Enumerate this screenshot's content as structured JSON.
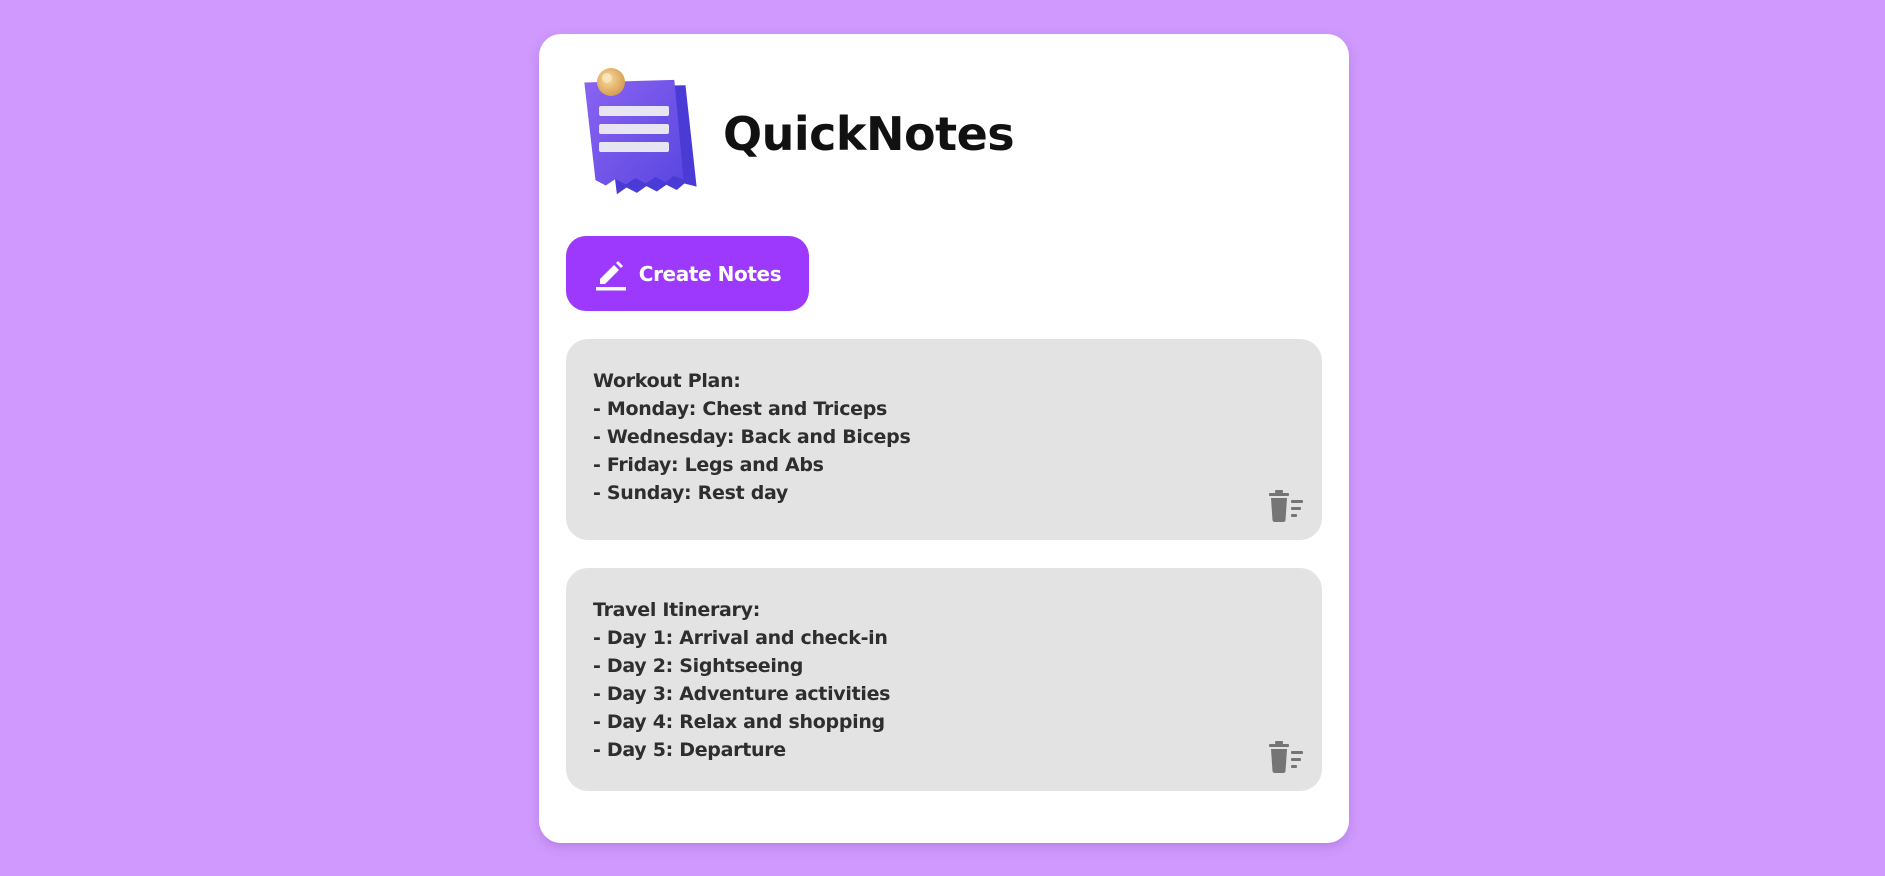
{
  "app": {
    "title": "QuickNotes",
    "logo_icon": "notes-logo-icon"
  },
  "toolbar": {
    "create_label": "Create Notes",
    "create_icon": "pencil-icon"
  },
  "notes": [
    {
      "text": "Workout Plan:\n- Monday: Chest and Triceps\n- Wednesday: Back and Biceps\n- Friday: Legs and Abs\n- Sunday: Rest day",
      "delete_icon": "delete-icon"
    },
    {
      "text": "Travel Itinerary:\n- Day 1: Arrival and check-in\n- Day 2: Sightseeing\n- Day 3: Adventure activities\n- Day 4: Relax and shopping\n- Day 5: Departure",
      "delete_icon": "delete-icon"
    }
  ],
  "colors": {
    "background": "#cf99fd",
    "card": "#ffffff",
    "accent": "#9d38fd",
    "note_background": "#e3e3e3",
    "note_text": "#2e2e2e",
    "icon_gray": "#757575"
  }
}
